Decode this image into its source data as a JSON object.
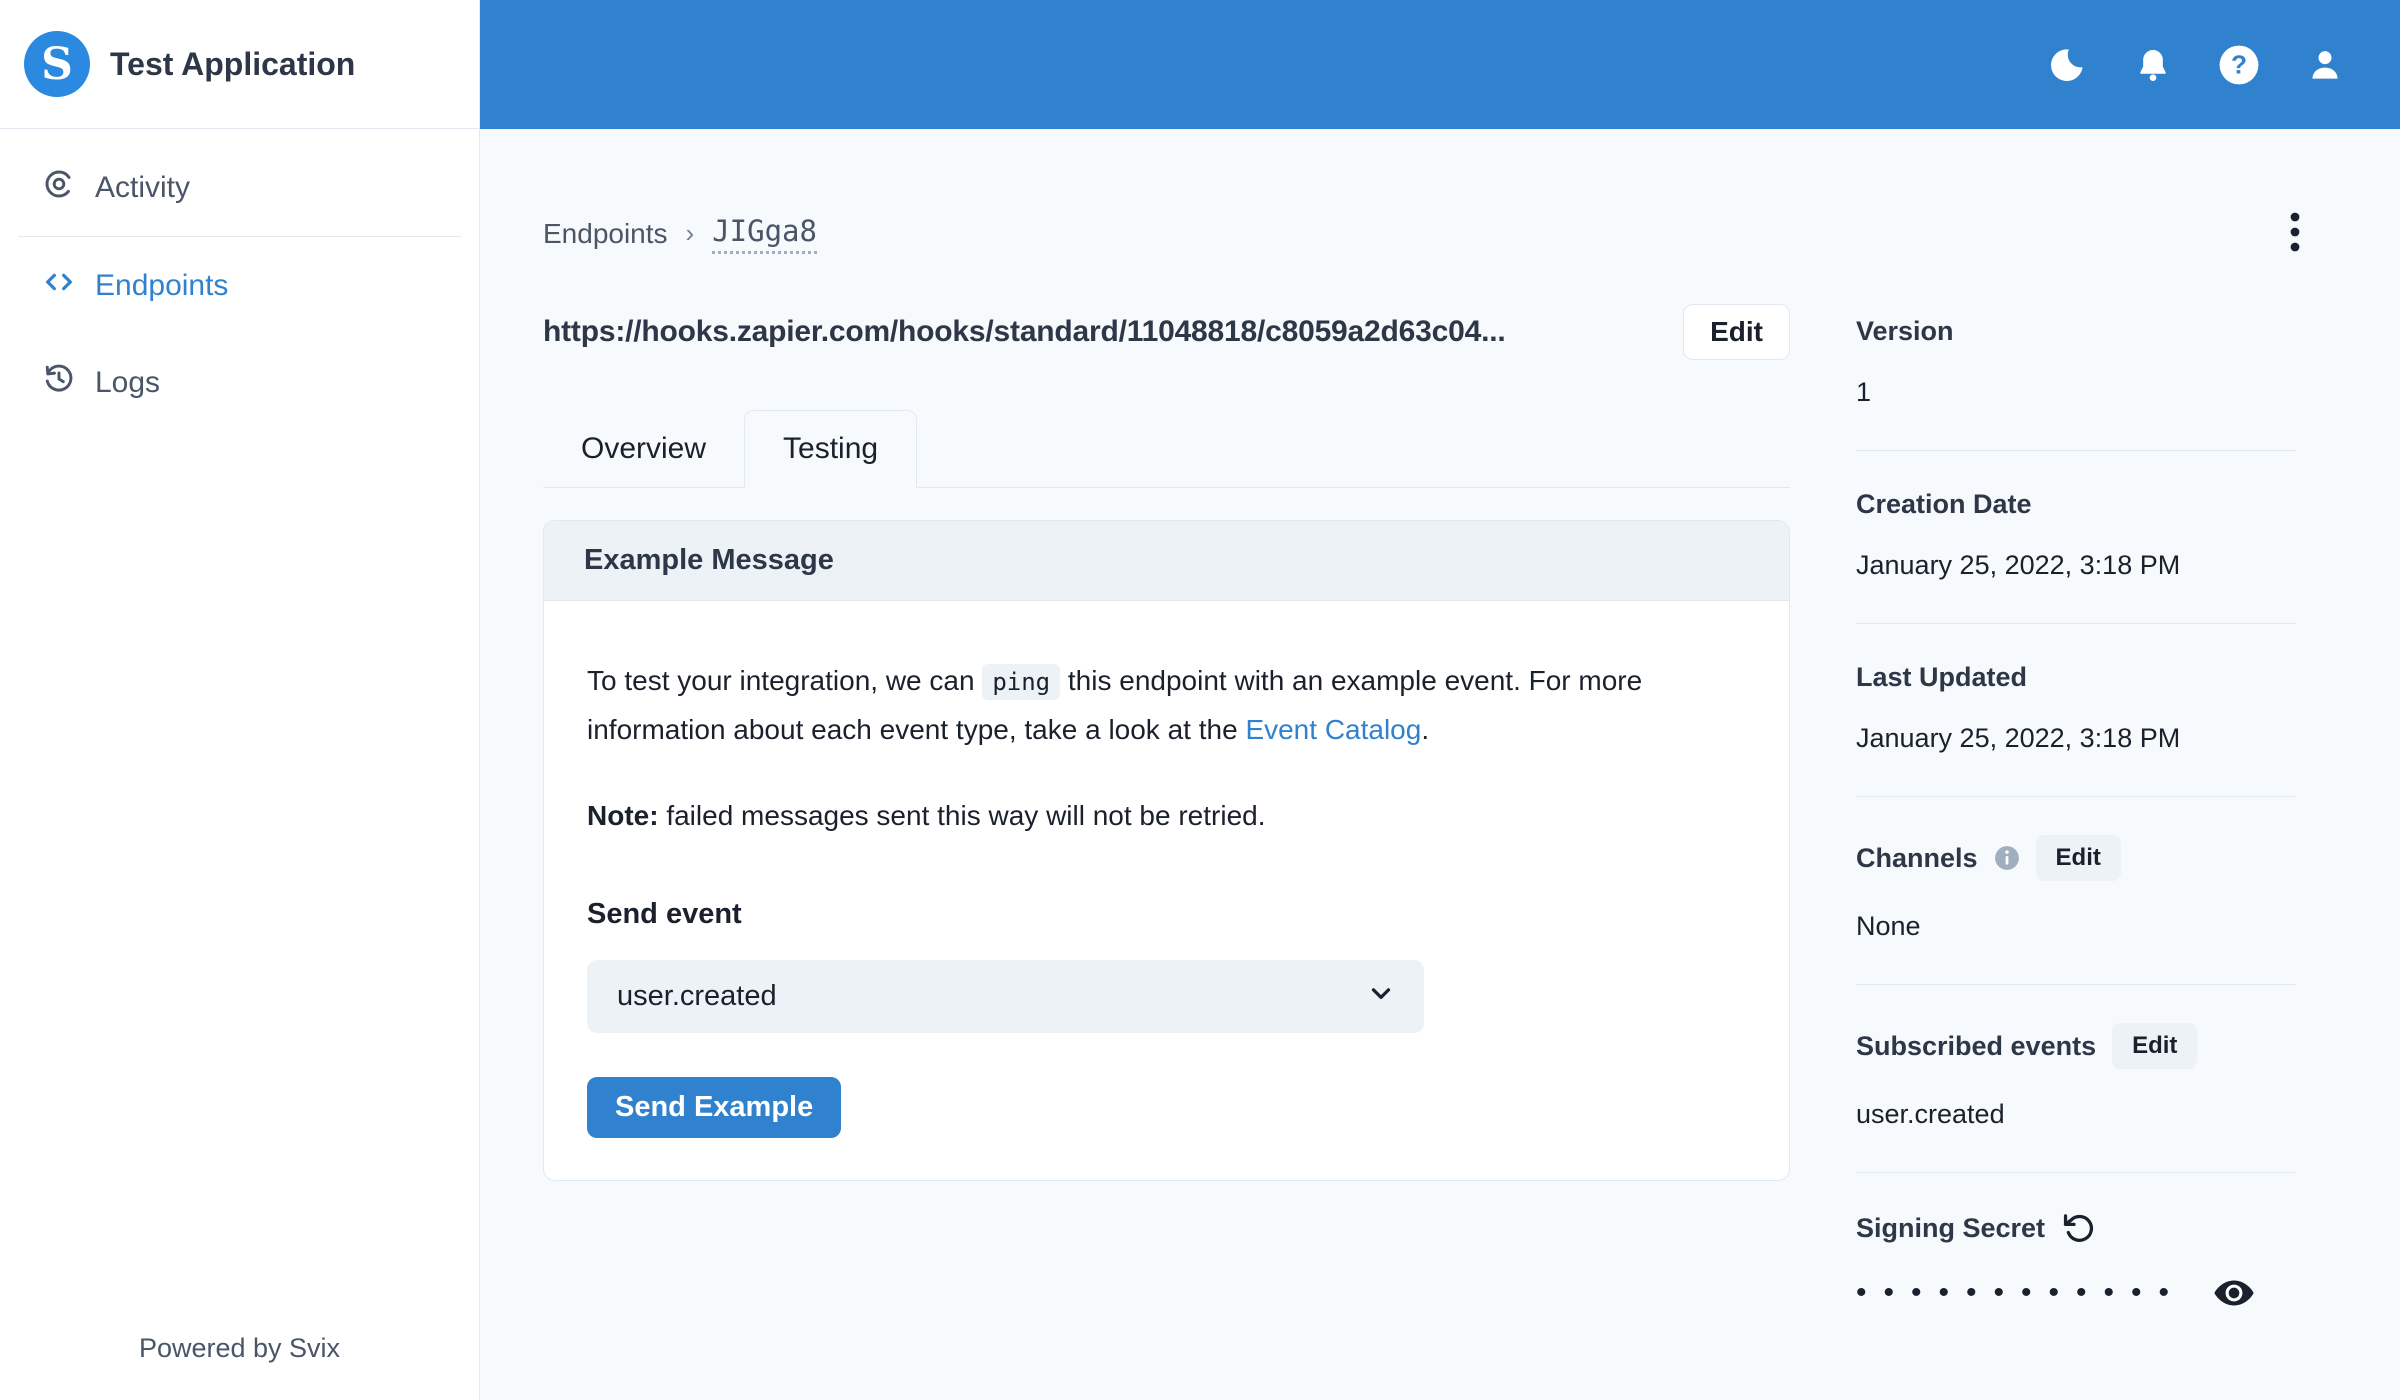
{
  "app": {
    "title": "Test Application",
    "logo_letter": "S",
    "powered_by": "Powered by Svix"
  },
  "sidebar": {
    "items": [
      {
        "label": "Activity",
        "icon": "activity-disc-icon",
        "active": false
      },
      {
        "label": "Endpoints",
        "icon": "code-brackets-icon",
        "active": true
      },
      {
        "label": "Logs",
        "icon": "history-clock-icon",
        "active": false
      }
    ]
  },
  "topbar": {
    "icons": [
      "dark-mode-moon-icon",
      "notifications-bell-icon",
      "help-question-icon",
      "user-account-icon"
    ]
  },
  "breadcrumb": {
    "parent": "Endpoints",
    "separator": "›",
    "current": "JIGga8"
  },
  "endpoint": {
    "url": "https://hooks.zapier.com/hooks/standard/11048818/c8059a2d63c04...",
    "edit_label": "Edit"
  },
  "tabs": [
    {
      "label": "Overview",
      "active": false
    },
    {
      "label": "Testing",
      "active": true
    }
  ],
  "example_message": {
    "title": "Example Message",
    "body_pre": "To test your integration, we can ",
    "code": "ping",
    "body_mid": " this endpoint with an example event. For more information about each event type, take a look at the ",
    "link_text": "Event Catalog",
    "body_end": ".",
    "note_label": "Note:",
    "note_text": "  failed messages sent this way will not be retried.",
    "send_event_label": "Send event",
    "select_value": "user.created",
    "send_button_label": "Send Example"
  },
  "details": {
    "version": {
      "label": "Version",
      "value": "1"
    },
    "creation_date": {
      "label": "Creation Date",
      "value": "January 25, 2022, 3:18 PM"
    },
    "last_updated": {
      "label": "Last Updated",
      "value": "January 25, 2022, 3:18 PM"
    },
    "channels": {
      "label": "Channels",
      "edit_label": "Edit",
      "value": "None"
    },
    "subscribed_events": {
      "label": "Subscribed events",
      "edit_label": "Edit",
      "value": "user.created"
    },
    "signing_secret": {
      "label": "Signing Secret",
      "masked_value": "••••••••••••"
    }
  },
  "colors": {
    "accent_blue": "#3182CE",
    "logo_blue": "#2b8ae0",
    "page_background": "#F7FAFC",
    "surface_white": "#FFFFFF",
    "subtle_gray": "#EDF2F7",
    "border_gray": "#E2E8F0",
    "text_dark": "#1A202C",
    "text_slate": "#2D3748",
    "text_secondary": "#4A5568",
    "info_gray": "#A0AEC0"
  }
}
